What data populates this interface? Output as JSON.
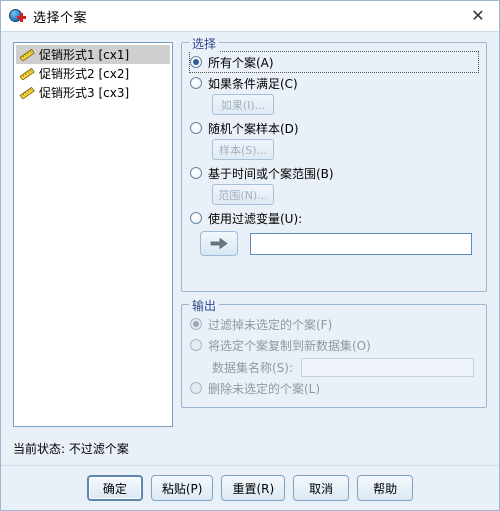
{
  "window": {
    "title": "选择个案",
    "icon": "select-cases-icon",
    "close_label": "✕"
  },
  "variable_list": {
    "items": [
      {
        "label": "促销形式1 [cx1]",
        "icon": "scale-ruler-icon",
        "selected": true
      },
      {
        "label": "促销形式2 [cx2]",
        "icon": "scale-ruler-icon",
        "selected": false
      },
      {
        "label": "促销形式3 [cx3]",
        "icon": "scale-ruler-icon",
        "selected": false
      }
    ]
  },
  "select_group": {
    "legend": "选择",
    "options": [
      {
        "label": "所有个案(A)",
        "checked": true,
        "enabled": true
      },
      {
        "label": "如果条件满足(C)",
        "checked": false,
        "enabled": true
      },
      {
        "label": "随机个案样本(D)",
        "checked": false,
        "enabled": true
      },
      {
        "label": "基于时间或个案范围(B)",
        "checked": false,
        "enabled": true
      },
      {
        "label": "使用过滤变量(U):",
        "checked": false,
        "enabled": true
      }
    ],
    "sub_buttons": {
      "if_label": "如果(I)...",
      "sample_label": "样本(S)...",
      "range_label": "范围(N)..."
    },
    "filter_arrow": "right-arrow-icon",
    "filter_value": ""
  },
  "output_group": {
    "legend": "输出",
    "options": [
      {
        "label": "过滤掉未选定的个案(F)",
        "checked": true,
        "enabled": false
      },
      {
        "label": "将选定个案复制到新数据集(O)",
        "checked": false,
        "enabled": false
      },
      {
        "label": "删除未选定的个案(L)",
        "checked": false,
        "enabled": false
      }
    ],
    "dataset_name_label": "数据集名称(S):",
    "dataset_name_value": ""
  },
  "status": {
    "text": "当前状态: 不过滤个案"
  },
  "footer": {
    "buttons": [
      {
        "label": "确定",
        "default": true
      },
      {
        "label": "粘贴(P)",
        "default": false
      },
      {
        "label": "重置(R)",
        "default": false
      },
      {
        "label": "取消",
        "default": false
      },
      {
        "label": "帮助",
        "default": false
      }
    ]
  },
  "colors": {
    "dialog_bg": "#e9f0f8",
    "titlebar_bg": "#ffffff",
    "group_border": "#9db6d0",
    "legend_text": "#33488f",
    "list_bg": "#ffffff",
    "list_border": "#7a9fc4",
    "selection_bg": "#cfcfcf",
    "radio_dot": "#2a6099",
    "disabled_text": "#9098a2"
  }
}
